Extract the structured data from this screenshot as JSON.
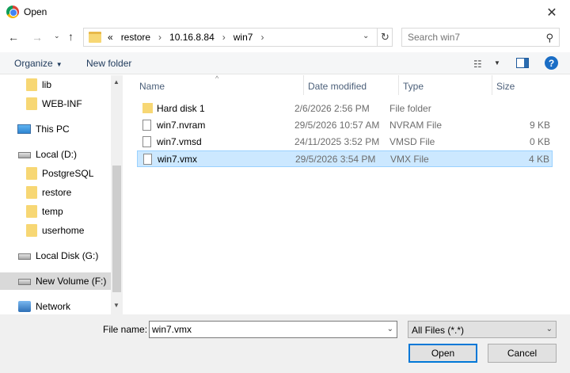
{
  "window": {
    "title": "Open",
    "close_glyph": "✕"
  },
  "address": {
    "crumbs": [
      "«",
      "restore",
      "10.16.8.84",
      "win7"
    ],
    "separator": "›",
    "trailing_separator": "›"
  },
  "search": {
    "placeholder": "Search win7"
  },
  "toolbar": {
    "organize_label": "Organize",
    "new_folder_label": "New folder",
    "help_glyph": "?"
  },
  "nav_pane": {
    "items": [
      {
        "label": "lib",
        "icon": "folder-icon"
      },
      {
        "label": "WEB-INF",
        "icon": "folder-icon"
      },
      {
        "label": "This PC",
        "icon": "computer-icon"
      },
      {
        "label": "Local (D:)",
        "icon": "drive-icon"
      },
      {
        "label": "PostgreSQL",
        "icon": "folder-icon"
      },
      {
        "label": "restore",
        "icon": "folder-icon"
      },
      {
        "label": "temp",
        "icon": "folder-icon"
      },
      {
        "label": "userhome",
        "icon": "folder-icon"
      },
      {
        "label": "Local Disk (G:)",
        "icon": "drive-icon"
      },
      {
        "label": "New Volume (F:)",
        "icon": "drive-icon",
        "selected": true
      },
      {
        "label": "Network",
        "icon": "network-icon"
      }
    ]
  },
  "file_list": {
    "columns": {
      "name": "Name",
      "date": "Date modified",
      "type": "Type",
      "size": "Size"
    },
    "rows": [
      {
        "name": "Hard disk 1",
        "date": "2/6/2026 2:56 PM",
        "type": "File folder",
        "size": "",
        "icon": "folder-icon"
      },
      {
        "name": "win7.nvram",
        "date": "29/5/2026 10:57 AM",
        "type": "NVRAM File",
        "size": "9 KB",
        "icon": "file-icon"
      },
      {
        "name": "win7.vmsd",
        "date": "24/11/2025 3:52 PM",
        "type": "VMSD File",
        "size": "0 KB",
        "icon": "file-icon"
      },
      {
        "name": "win7.vmx",
        "date": "29/5/2026 3:54 PM",
        "type": "VMX File",
        "size": "4 KB",
        "icon": "file-icon",
        "selected": true
      }
    ]
  },
  "bottom": {
    "file_name_label": "File name:",
    "file_name_value": "win7.vmx",
    "filter_value": "All Files (*.*)",
    "open_label": "Open",
    "cancel_label": "Cancel"
  }
}
